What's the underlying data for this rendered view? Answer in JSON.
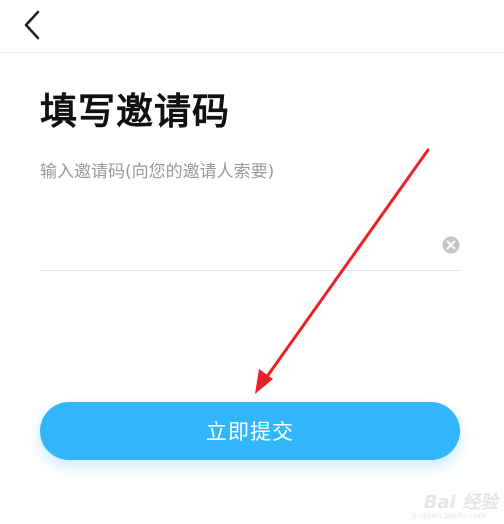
{
  "header": {
    "back_icon": "chevron-left-icon"
  },
  "page": {
    "title": "填写邀请码",
    "hint": "输入邀请码(向您的邀请人索要)"
  },
  "invite_input": {
    "value": "",
    "placeholder": "",
    "clear_icon": "clear-circle-icon"
  },
  "submit": {
    "label": "立即提交",
    "color": "#32b6fb"
  },
  "annotation": {
    "arrow_color": "#e8222a"
  },
  "watermark": {
    "brand": "Bai 经验",
    "domain": "jingyan.baidu.com"
  }
}
